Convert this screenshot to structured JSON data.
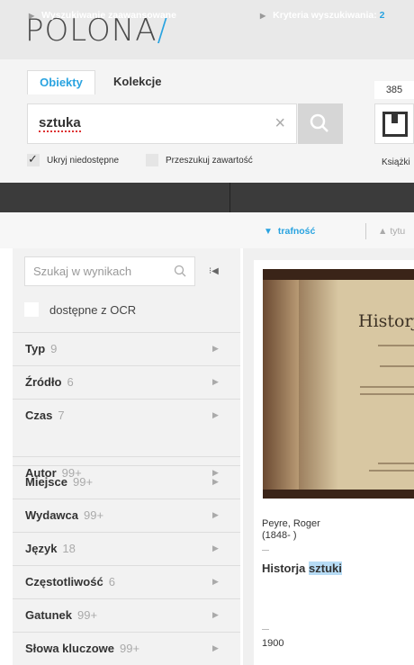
{
  "logo": {
    "text": "POLONA",
    "slash": "/"
  },
  "tabs": [
    {
      "label": "Obiekty"
    },
    {
      "label": "Kolekcje"
    }
  ],
  "search": {
    "value": "sztuka",
    "clear": "×"
  },
  "result_type": {
    "count": "385",
    "label": "Książki"
  },
  "options": [
    {
      "label": "Ukryj niedostępne",
      "checked": true
    },
    {
      "label": "Przeszukuj zawartość",
      "checked": false
    }
  ],
  "toolbar": {
    "advanced": "Wyszukiwanie zaawansowane",
    "criteria": "Kryteria wyszukiwania:",
    "criteria_count": "2"
  },
  "sort": {
    "active": "trafność",
    "other": "tytu"
  },
  "sidebar": {
    "search_placeholder": "Szukaj w wynikach",
    "ocr_label": "dostępne z OCR",
    "facets": [
      {
        "name": "Typ",
        "count": "9"
      },
      {
        "name": "Źródło",
        "count": "6"
      },
      {
        "name": "Czas",
        "count": "7"
      },
      {
        "name": "Autor",
        "count": "99+"
      },
      {
        "name": "Miejsce",
        "count": "99+"
      },
      {
        "name": "Wydawca",
        "count": "99+"
      },
      {
        "name": "Język",
        "count": "18"
      },
      {
        "name": "Częstotliwość",
        "count": "6"
      },
      {
        "name": "Gatunek",
        "count": "99+"
      },
      {
        "name": "Słowa kluczowe",
        "count": "99+"
      }
    ]
  },
  "result": {
    "thumb_title": "Historja",
    "author_name": "Peyre, Roger",
    "author_dates": "(1848- )",
    "title_plain": "Historja ",
    "title_highlight": "sztuki",
    "year": "1900"
  },
  "colors": {
    "accent": "#29a3e0",
    "bar": "#3b3b3b",
    "highlight": "#b7dcf5"
  }
}
